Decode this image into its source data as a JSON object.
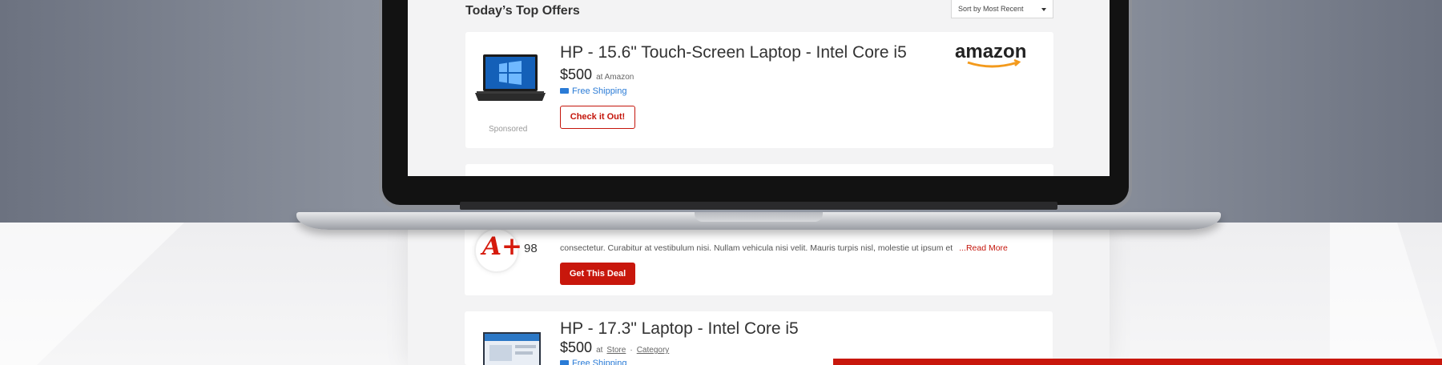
{
  "section_title": "Today’s Top Offers",
  "sort": {
    "label": "Sort by Most Recent"
  },
  "offer1": {
    "title": "HP - 15.6\" Touch-Screen Laptop - Intel Core i5",
    "price": "$500",
    "price_at": "at Amazon",
    "shipping": "Free Shipping",
    "button": "Check it Out!",
    "sponsored": "Sponsored",
    "store_logo": "amazon"
  },
  "deal": {
    "grade": "A+",
    "score": "98",
    "review": "consectetur. Curabitur at vestibulum nisi. Nullam vehicula nisi velit. Mauris turpis nisl, molestie ut ipsum et",
    "read_more": "...Read More",
    "button": "Get This Deal"
  },
  "offer2": {
    "title": "HP - 17.3\" Laptop - Intel Core i5",
    "price": "$500",
    "price_at": "at",
    "store_link": "Store",
    "separator": "·",
    "category_link": "Category",
    "shipping": "Free Shipping"
  },
  "colors": {
    "accent": "#c8170c",
    "link_blue": "#2a7bd6"
  }
}
